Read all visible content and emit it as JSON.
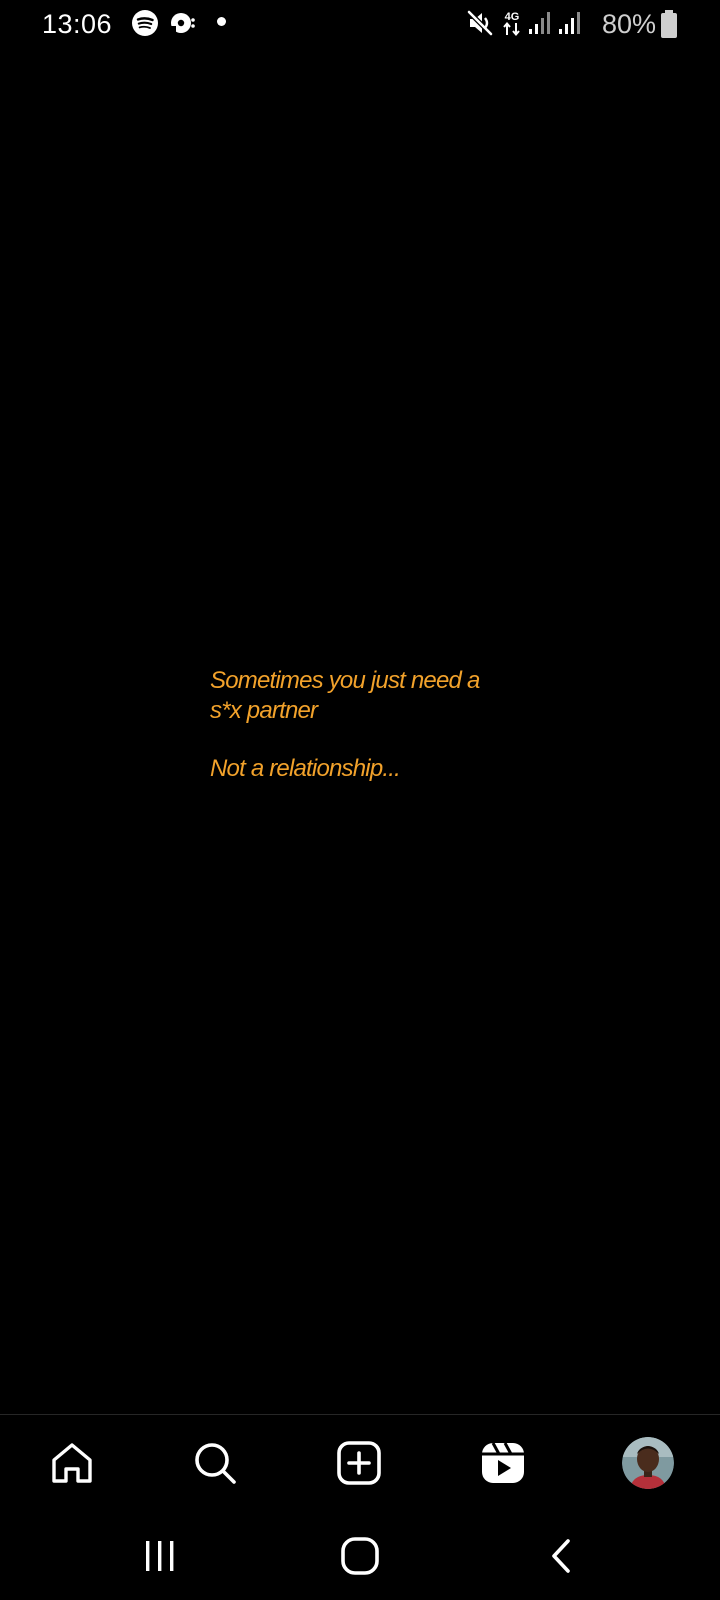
{
  "status_bar": {
    "time": "13:06",
    "battery_percent": "80%",
    "network_type": "4G",
    "icons": [
      "spotify-icon",
      "podcast-icon",
      "notification-dot-icon",
      "mute-icon",
      "network-4g-icon",
      "signal-icon",
      "signal-icon",
      "battery-icon"
    ]
  },
  "story": {
    "line1": "Sometimes you just need a",
    "line2": "s*x partner",
    "line3": "Not a relationship...",
    "text_color": "#f2a22b",
    "background_color": "#000000"
  },
  "tab_bar": {
    "items": [
      {
        "name": "home",
        "icon": "home-icon"
      },
      {
        "name": "search",
        "icon": "search-icon"
      },
      {
        "name": "create",
        "icon": "plus-square-icon"
      },
      {
        "name": "reels",
        "icon": "reels-icon"
      },
      {
        "name": "profile",
        "icon": "avatar"
      }
    ]
  },
  "nav_bar": {
    "items": [
      "recents-icon",
      "home-circle-icon",
      "back-icon"
    ]
  }
}
